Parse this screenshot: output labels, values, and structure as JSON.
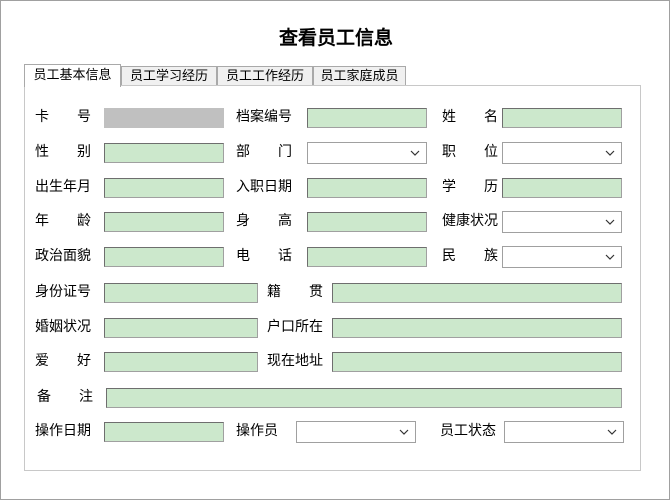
{
  "window": {
    "title": "查看员工信息"
  },
  "tabs": [
    {
      "label": "员工基本信息",
      "active": true
    },
    {
      "label": "员工学习经历",
      "active": false
    },
    {
      "label": "员工工作经历",
      "active": false
    },
    {
      "label": "员工家庭成员",
      "active": false
    }
  ],
  "labels": {
    "card_a": "卡",
    "card_b": "号",
    "archive_no": "档案编号",
    "name_a": "姓",
    "name_b": "名",
    "gender_a": "性",
    "gender_b": "别",
    "dept_a": "部",
    "dept_b": "门",
    "position_a": "职",
    "position_b": "位",
    "birth": "出生年月",
    "hire_date": "入职日期",
    "edu_a": "学",
    "edu_b": "历",
    "age_a": "年",
    "age_b": "龄",
    "height_a": "身",
    "height_b": "高",
    "health": "健康状况",
    "politics": "政治面貌",
    "phone_a": "电",
    "phone_b": "话",
    "ethnic_a": "民",
    "ethnic_b": "族",
    "id_card": "身份证号",
    "native_a": "籍",
    "native_b": "贯",
    "marital": "婚姻状况",
    "household": "户口所在",
    "hobby_a": "爱",
    "hobby_b": "好",
    "address": "现在地址",
    "remark_a": "备",
    "remark_b": "注",
    "op_date": "操作日期",
    "operator": "操作员",
    "status": "员工状态"
  },
  "fields": {
    "card_no": "",
    "archive_no": "",
    "name": "",
    "gender": "",
    "department": "",
    "position": "",
    "birth": "",
    "hire_date": "",
    "education": "",
    "age": "",
    "height": "",
    "health": "",
    "politics": "",
    "phone": "",
    "ethnic": "",
    "id_card": "",
    "native_place": "",
    "marital": "",
    "household": "",
    "hobby": "",
    "address": "",
    "remark": "",
    "op_date": "",
    "operator": "",
    "status": ""
  },
  "icons": {
    "dropdown": "chevron-down-icon"
  }
}
